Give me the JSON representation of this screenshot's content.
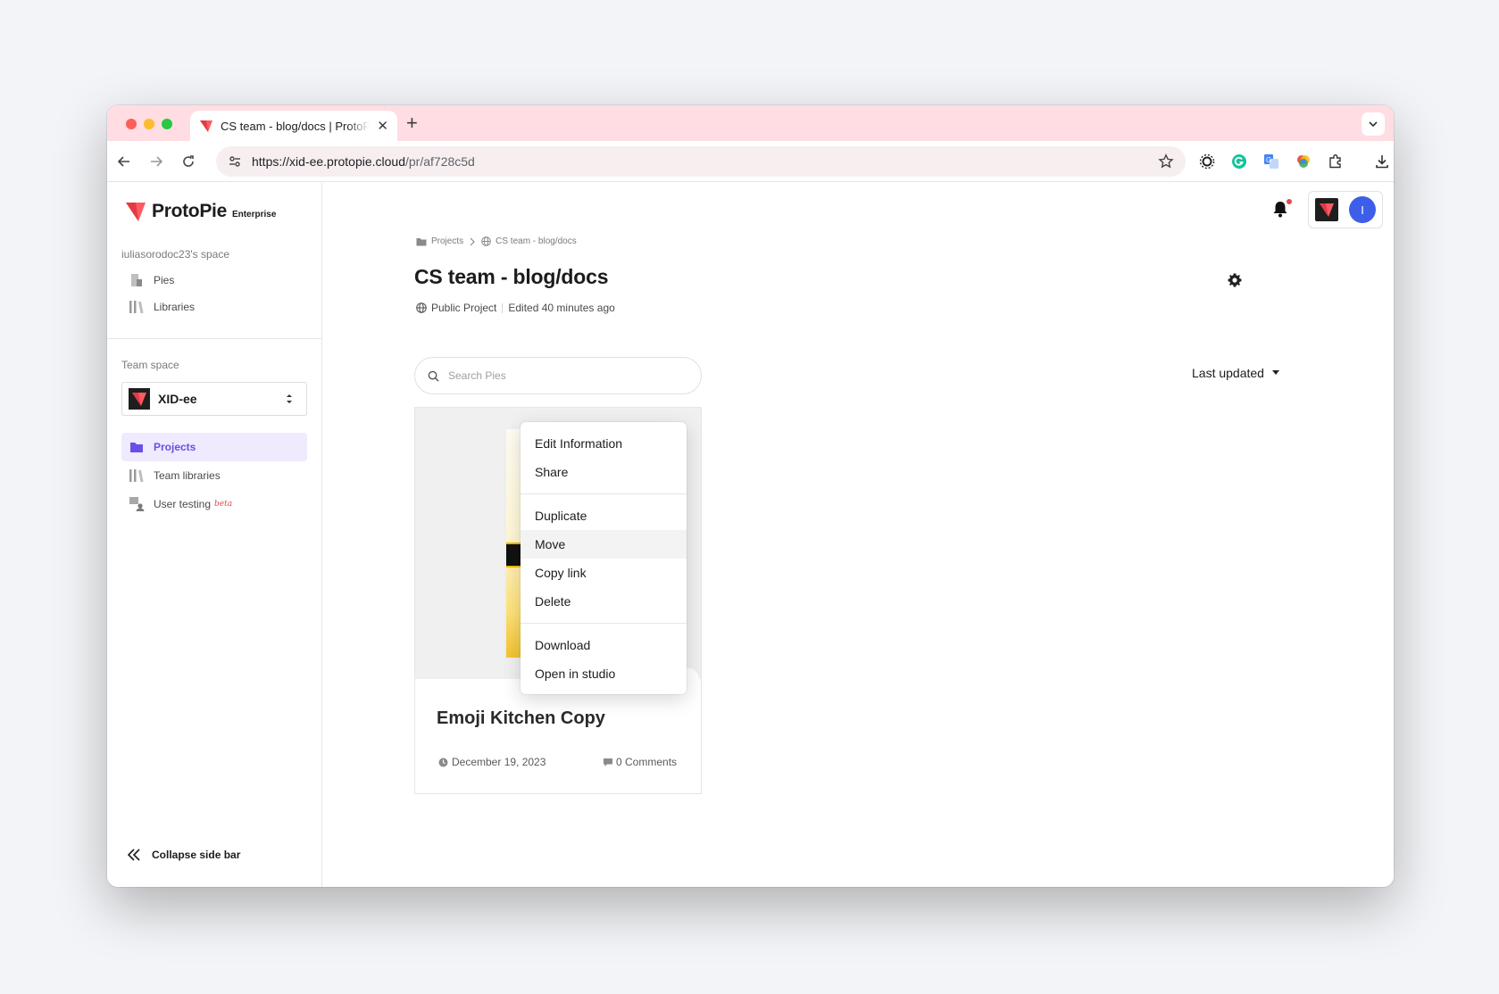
{
  "browser": {
    "tab_title": "CS team - blog/docs | ProtoPie",
    "url_host": "https://xid-ee.protopie.cloud",
    "url_path": "/pr/af728c5d"
  },
  "sidebar": {
    "brand": "ProtoPie",
    "brand_sub": "Enterprise",
    "personal_space": "iuliasorodoc23's space",
    "personal_items": [
      {
        "label": "Pies",
        "icon": "pies-icon"
      },
      {
        "label": "Libraries",
        "icon": "libraries-icon"
      }
    ],
    "team_space_label": "Team space",
    "team_name": "XID-ee",
    "team_items": [
      {
        "label": "Projects",
        "icon": "folder-icon",
        "active": true
      },
      {
        "label": "Team libraries",
        "icon": "libraries-icon"
      },
      {
        "label": "User testing",
        "icon": "user-testing-icon",
        "badge": "beta"
      }
    ],
    "collapse_label": "Collapse side bar"
  },
  "header": {
    "avatar_initial": "I"
  },
  "main": {
    "breadcrumb": [
      "Projects",
      "CS team - blog/docs"
    ],
    "title": "CS team - blog/docs",
    "visibility": "Public Project",
    "edited": "Edited 40 minutes ago",
    "search_placeholder": "Search Pies",
    "sort_label": "Last updated"
  },
  "card": {
    "title": "Emoji Kitchen Copy",
    "date": "December 19, 2023",
    "comments": "0 Comments"
  },
  "context_menu": {
    "groups": [
      [
        "Edit Information",
        "Share"
      ],
      [
        "Duplicate",
        "Move",
        "Copy link",
        "Delete"
      ],
      [
        "Download",
        "Open in studio"
      ]
    ],
    "hovered": "Move"
  },
  "colors": {
    "accent": "#6a4ee8",
    "brand_red": "#ff5a5f",
    "tab_strip": "#ffdde2",
    "avatar": "#3d5ee8"
  }
}
